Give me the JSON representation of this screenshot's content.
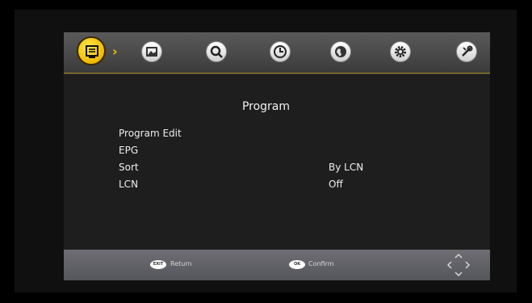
{
  "menu": {
    "title": "Program",
    "items": [
      {
        "label": "Program Edit",
        "value": ""
      },
      {
        "label": "EPG",
        "value": ""
      },
      {
        "label": "Sort",
        "value": "By LCN"
      },
      {
        "label": "LCN",
        "value": "Off"
      }
    ]
  },
  "tabs": [
    {
      "icon": "program-icon",
      "active": true
    },
    {
      "icon": "picture-icon",
      "active": false
    },
    {
      "icon": "search-icon",
      "active": false
    },
    {
      "icon": "clock-icon",
      "active": false
    },
    {
      "icon": "globe-icon",
      "active": false
    },
    {
      "icon": "gear-icon",
      "active": false
    },
    {
      "icon": "tools-icon",
      "active": false
    }
  ],
  "footer": {
    "return_key": "EXIT",
    "return_label": "Return",
    "confirm_key": "OK",
    "confirm_label": "Confirm"
  },
  "colors": {
    "accent": "#f0c400",
    "background": "#1e1e1e",
    "footer": "#606066"
  }
}
